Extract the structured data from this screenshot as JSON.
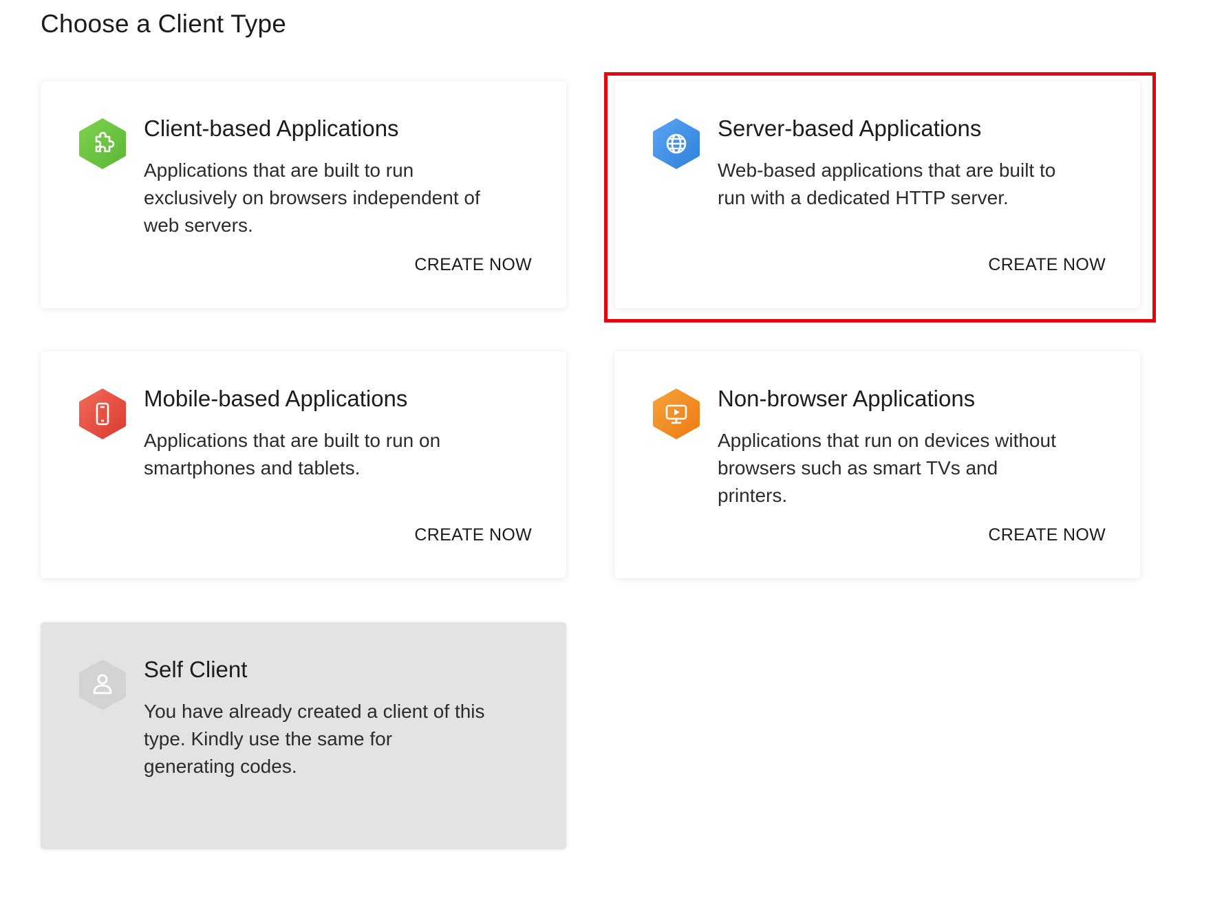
{
  "page": {
    "title": "Choose a Client Type"
  },
  "cards": [
    {
      "title": "Client-based Applications",
      "description": "Applications that are built to run exclusively on browsers independent of web servers.",
      "action": "CREATE NOW",
      "icon": "puzzle-icon",
      "icon_color": "#6cc644"
    },
    {
      "title": "Server-based Applications",
      "description": "Web-based applications that are built to run with a dedicated HTTP server.",
      "action": "CREATE NOW",
      "icon": "globe-icon",
      "icon_color": "#3d8ee8",
      "highlighted": true,
      "highlight_color": "#e20612"
    },
    {
      "title": "Mobile-based Applications",
      "description": "Applications that are built to run on smartphones and tablets.",
      "action": "CREATE NOW",
      "icon": "smartphone-icon",
      "icon_color": "#e84c3d"
    },
    {
      "title": "Non-browser Applications",
      "description": "Applications that run on devices without browsers such as smart TVs and printers.",
      "action": "CREATE NOW",
      "icon": "monitor-icon",
      "icon_color": "#f28c1e"
    },
    {
      "title": "Self Client",
      "description": "You have already created a client of this type. Kindly use the same for generating codes.",
      "icon": "user-icon",
      "icon_color": "#d6d6d6",
      "disabled": true
    }
  ]
}
